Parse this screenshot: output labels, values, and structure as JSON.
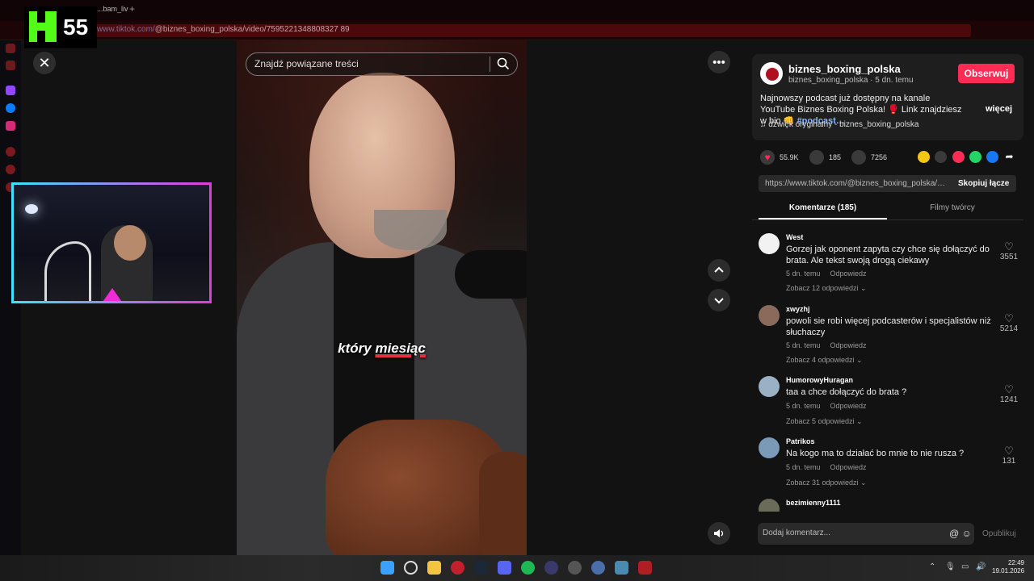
{
  "browser": {
    "tab_title": "...bam_liv",
    "new_tab": "+",
    "url_prefix": "www.tiktok.com/",
    "url_path": "@biznes_boxing_polska/video/7595221348808327 89"
  },
  "kick": {
    "viewer_count": "55",
    "brand_color": "#53fc18"
  },
  "video": {
    "caption_before": "który ",
    "caption_highlight": "miesiąc",
    "search_placeholder": "Znajdź powiązane treści",
    "close_label": "✕",
    "more_label": "•••"
  },
  "creator": {
    "username": "biznes_boxing_polska",
    "subline": "biznes_boxing_polska · 5 dn. temu",
    "follow_label": "Obserwuj",
    "description": "Najnowszy podcast już dostępny na kanale YouTube Biznes Boxing Polska! 🥊 Link znajdziesz w bio 👊 ",
    "hashtag": "#podcast…",
    "more_label": "więcej",
    "sound": "♫  dźwięk oryginalny - biznes_boxing_polska"
  },
  "stats": {
    "likes": "55.9K",
    "comments": "185",
    "saves": "7256"
  },
  "link": {
    "url": "https://www.tiktok.com/@biznes_boxing_polska/video/7595221348808327 89",
    "copy_label": "Skopiuj łącze"
  },
  "tabs": {
    "comments": "Komentarze (185)",
    "creator_videos": "Filmy twórcy"
  },
  "comments": [
    {
      "user": "West",
      "text": "Gorzej jak oponent zapyta czy chce się dołączyć do brata. Ale tekst swoją drogą ciekawy",
      "time": "5 dn. temu",
      "reply": "Odpowiedz",
      "replies": "Zobacz 12 odpowiedzi ⌄",
      "likes": "3551"
    },
    {
      "user": "xwyzhj",
      "text": "powoli sie robi więcej podcasterów i specjalistów niż słuchaczy",
      "time": "5 dn. temu",
      "reply": "Odpowiedz",
      "replies": "Zobacz 4 odpowiedzi ⌄",
      "likes": "5214"
    },
    {
      "user": "HumorowyHuragan",
      "text": "taa a chce dołączyć do brata ?",
      "time": "5 dn. temu",
      "reply": "Odpowiedz",
      "replies": "Zobacz 5 odpowiedzi ⌄",
      "likes": "1241"
    },
    {
      "user": "Patrikos",
      "text": "Na kogo ma to działać bo mnie to nie rusza ?",
      "time": "5 dn. temu",
      "reply": "Odpowiedz",
      "replies": "Zobacz 31 odpowiedzi ⌄",
      "likes": "131"
    },
    {
      "user": "bezimienny1111",
      "text": "",
      "time": "",
      "reply": "",
      "replies": "",
      "likes": ""
    }
  ],
  "comment_input": {
    "placeholder": "Dodaj komentarz...",
    "icons": "@ ☺",
    "post_label": "Opublikuj"
  },
  "taskbar": {
    "time": "22:49",
    "date": "19.01.2026"
  },
  "colors": {
    "accent": "#fe2c55",
    "browser": "#1c0507"
  }
}
